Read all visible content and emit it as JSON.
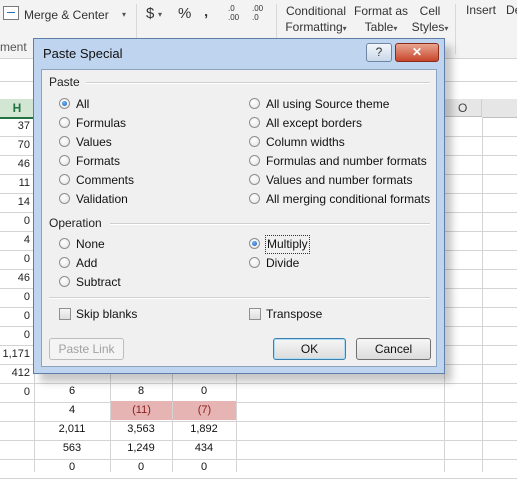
{
  "ribbon": {
    "merge_center": "Merge & Center",
    "dollar": "$",
    "percent": "%",
    "comma": "‚",
    "inc_decimal_top": ".0",
    "inc_decimal_bottom": ".00",
    "dec_decimal_top": ".00",
    "dec_decimal_bottom": ".0",
    "conditional_formatting_1": "Conditional",
    "conditional_formatting_2": "Formatting",
    "format_as_table_1": "Format as",
    "format_as_table_2": "Table",
    "cell_styles_1": "Cell",
    "cell_styles_2": "Styles",
    "insert": "Insert",
    "delete_partial": "De",
    "alignment_group_partial": "ment",
    "caret": "▾"
  },
  "sheet": {
    "col_h": "H",
    "col_o": "O",
    "col_h_values": [
      "37",
      "70",
      "46",
      "11",
      "14",
      "0",
      "4",
      "0",
      "46",
      "0",
      "0",
      "0",
      "1,171",
      "412",
      "0"
    ],
    "rows_bottom": [
      [
        "6",
        "8",
        "0"
      ],
      [
        "4",
        "(11)",
        "(7)"
      ],
      [
        "2,011",
        "3,563",
        "1,892"
      ],
      [
        "563",
        "1,249",
        "434"
      ],
      [
        "0",
        "0",
        "0"
      ]
    ]
  },
  "dialog": {
    "title": "Paste Special",
    "help": "?",
    "close": "✕",
    "paste_group": "Paste",
    "paste_left": [
      "All",
      "Formulas",
      "Values",
      "Formats",
      "Comments",
      "Validation"
    ],
    "paste_right": [
      "All using Source theme",
      "All except borders",
      "Column widths",
      "Formulas and number formats",
      "Values and number formats",
      "All merging conditional formats"
    ],
    "operation_group": "Operation",
    "op_left": [
      "None",
      "Add",
      "Subtract"
    ],
    "op_right": [
      "Multiply",
      "Divide"
    ],
    "skip_blanks": "Skip blanks",
    "transpose": "Transpose",
    "paste_link": "Paste Link",
    "ok": "OK",
    "cancel": "Cancel"
  }
}
